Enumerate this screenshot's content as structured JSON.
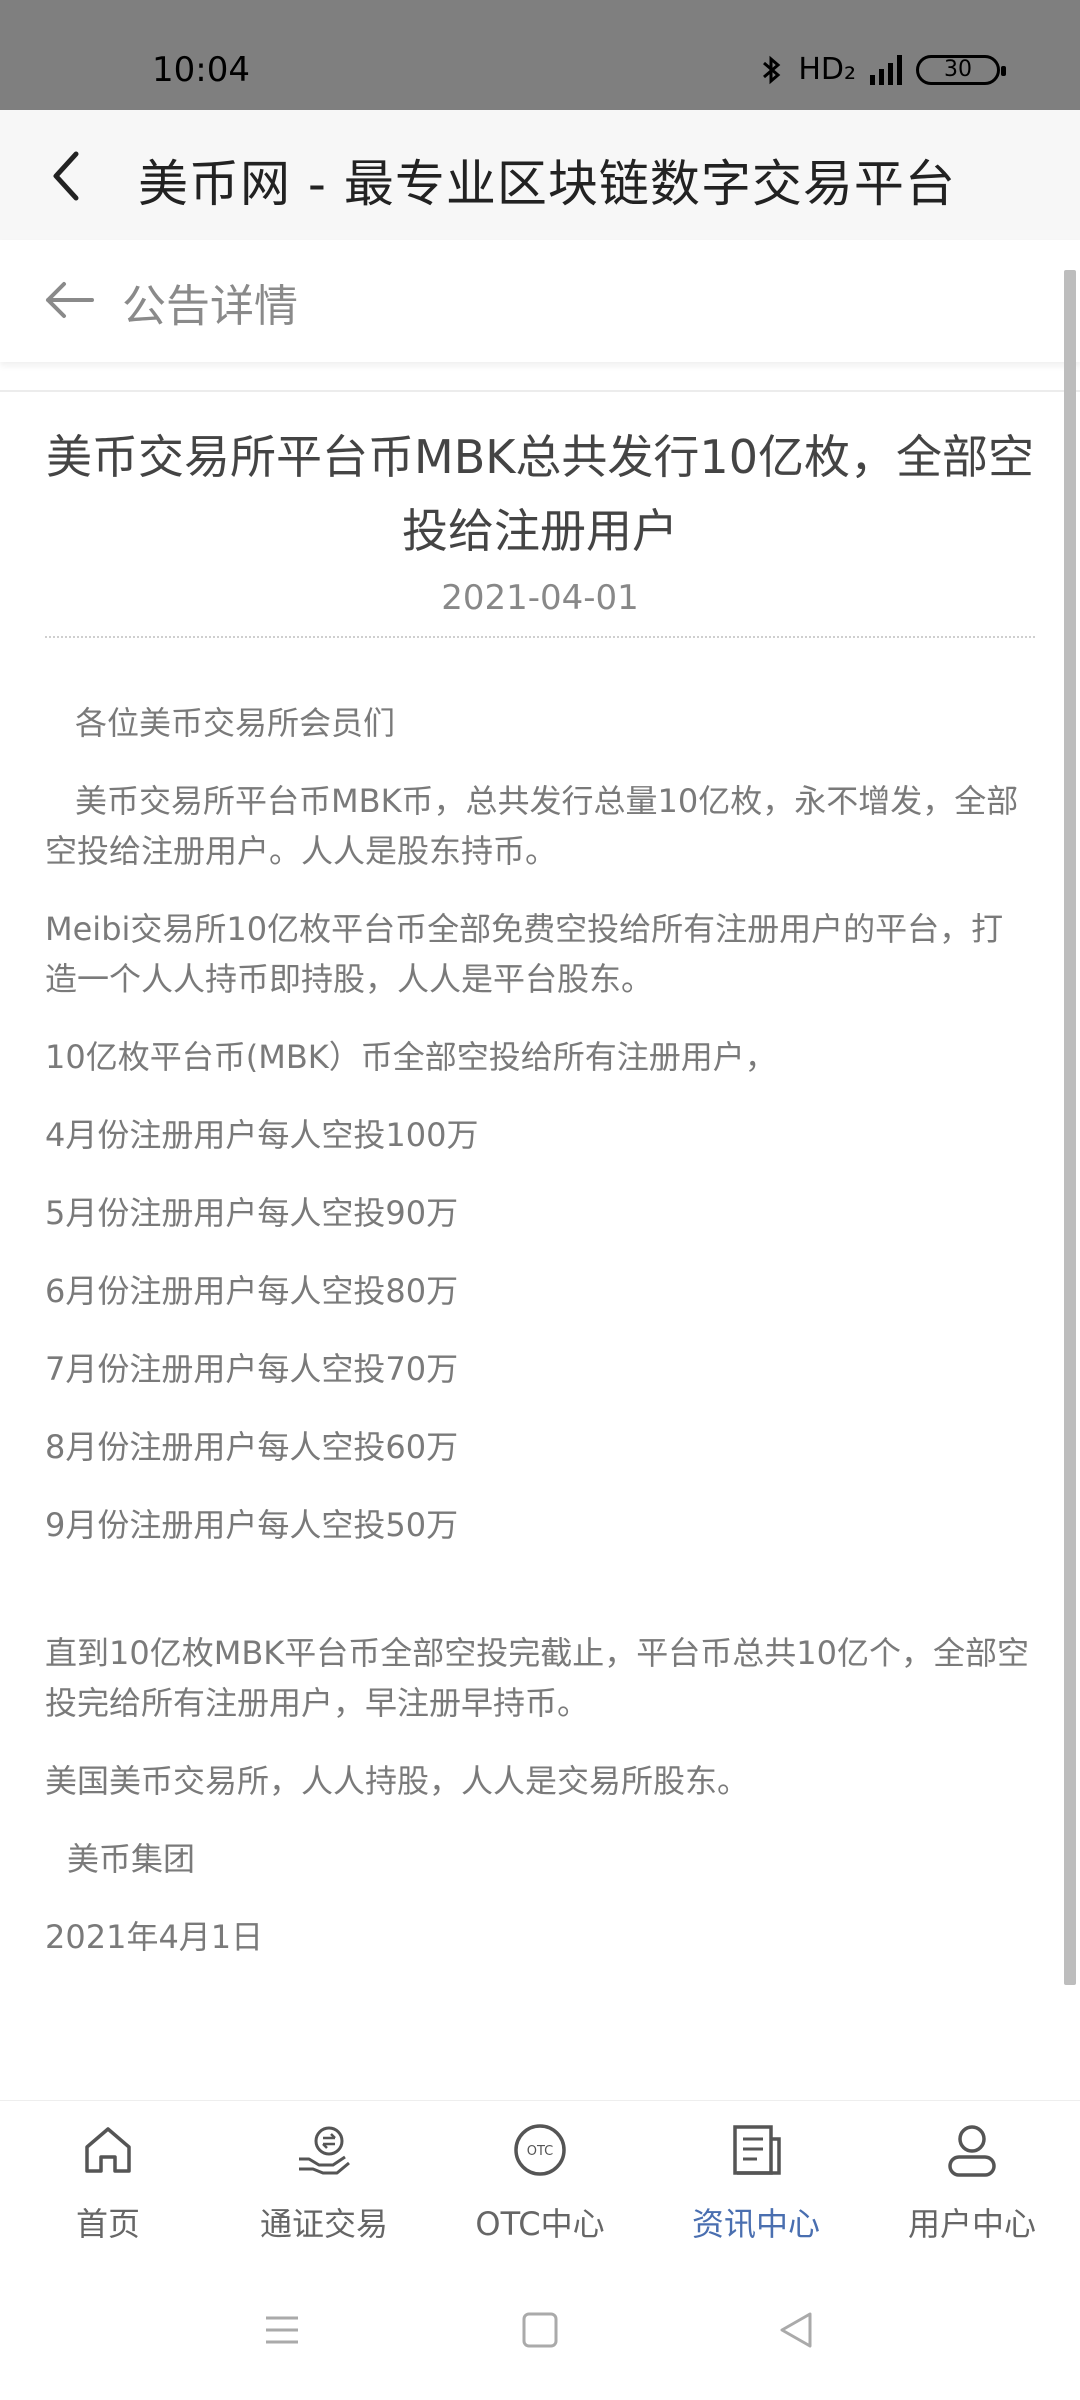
{
  "status_bar": {
    "time": "10:04",
    "network": "HD₂",
    "battery": "30"
  },
  "app_bar": {
    "title": "美币网 - 最专业区块链数字交易平台"
  },
  "sub_header": {
    "title": "公告详情"
  },
  "article": {
    "headline": "美币交易所平台币MBK总共发行10亿枚，全部空投给注册用户",
    "date": "2021-04-01",
    "paragraphs": {
      "p1": "各位美币交易所会员们",
      "p2": "美币交易所平台币MBK币，总共发行总量10亿枚，永不增发，全部空投给注册用户。人人是股东持币。",
      "p3": "Meibi交易所10亿枚平台币全部免费空投给所有注册用户的平台，打造一个人人持币即持股，人人是平台股东。",
      "p4": "10亿枚平台币(MBK）币全部空投给所有注册用户，",
      "p5": "4月份注册用户每人空投100万",
      "p6": "5月份注册用户每人空投90万",
      "p7": "6月份注册用户每人空投80万",
      "p8": "7月份注册用户每人空投70万",
      "p9": "8月份注册用户每人空投60万",
      "p10": "9月份注册用户每人空投50万",
      "p11": "直到10亿枚MBK平台币全部空投完截止，平台币总共10亿个，全部空投完给所有注册用户，早注册早持币。",
      "p12": "美国美币交易所，人人持股，人人是交易所股东。",
      "p13": "美币集团",
      "p14": "2021年4月1日"
    }
  },
  "tabs": {
    "home": "首页",
    "trade": "通证交易",
    "otc": "OTC中心",
    "news": "资讯中心",
    "user": "用户中心",
    "otc_icon_text": "OTC"
  },
  "colors": {
    "active_tab": "#4a6fb0",
    "status_bar": "#7f7f7f"
  }
}
